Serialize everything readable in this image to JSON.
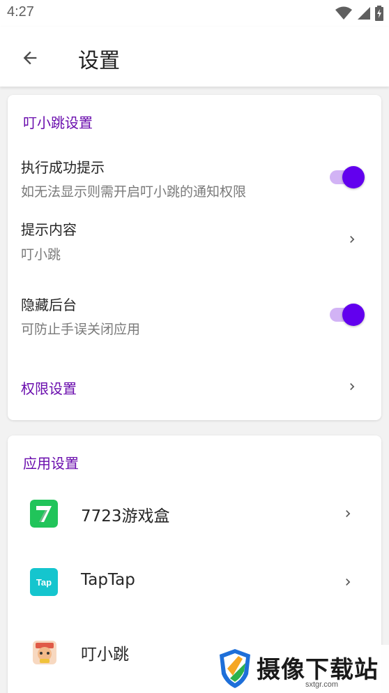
{
  "status_bar": {
    "time": "4:27"
  },
  "app_bar": {
    "title": "设置"
  },
  "card_notify": {
    "section_title": "叮小跳设置",
    "items": [
      {
        "title": "执行成功提示",
        "subtitle": "如无法显示则需开启叮小跳的通知权限",
        "toggle_on": true
      },
      {
        "title": "提示内容",
        "subtitle": "叮小跳"
      },
      {
        "title": "隐藏后台",
        "subtitle": "可防止手误关闭应用",
        "toggle_on": true
      },
      {
        "title": "权限设置"
      }
    ]
  },
  "card_apps": {
    "section_title": "应用设置",
    "apps": [
      {
        "name": "7723游戏盒",
        "icon": "7723-app-icon"
      },
      {
        "name": "TapTap",
        "icon": "taptap-app-icon",
        "icon_text": "Tap"
      },
      {
        "name": "叮小跳",
        "icon": "dingxiaotiao-app-icon"
      }
    ]
  },
  "watermark": {
    "text": "摄像下载站",
    "url": "sxtgr.com"
  },
  "colors": {
    "accent": "#6a0dad",
    "toggle_thumb": "#6200ee",
    "toggle_track": "#d2b3f5"
  }
}
